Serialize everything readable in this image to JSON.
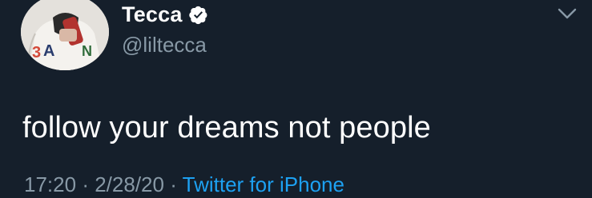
{
  "user": {
    "display_name": "Tecca",
    "handle": "@liltecca",
    "verified": true,
    "avatar_icon": "profile-avatar"
  },
  "tweet": {
    "text": "follow your dreams not people",
    "time": "17:20",
    "date": "2/28/20",
    "separator": "·",
    "source": "Twitter for iPhone"
  },
  "icons": {
    "verified": "verified-badge-icon",
    "menu": "chevron-down-icon"
  },
  "colors": {
    "background": "#151f2b",
    "text": "#ffffff",
    "muted": "#8899a6",
    "link": "#1da1f2"
  }
}
